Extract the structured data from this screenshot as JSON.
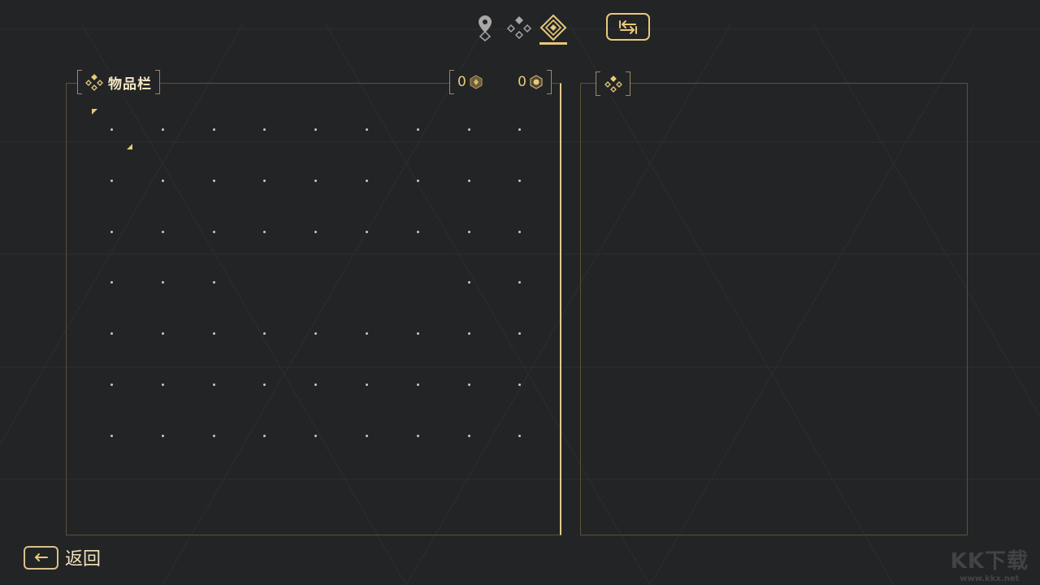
{
  "tabs": [
    {
      "icon": "map-pin-icon",
      "active": false
    },
    {
      "icon": "rune-diamond-icon",
      "active": false
    },
    {
      "icon": "inventory-diamond-icon",
      "active": true
    }
  ],
  "swap_button": {
    "icon": "swap-arrows-icon"
  },
  "inventory": {
    "title": "物品栏",
    "currencies": [
      {
        "value": "0",
        "icon": "rune-coin-icon"
      },
      {
        "value": "0",
        "icon": "hex-gem-icon"
      }
    ],
    "grid": {
      "columns": 9,
      "rows": 7,
      "empty_cells": [
        [
          3,
          3
        ],
        [
          3,
          4
        ],
        [
          3,
          5
        ],
        [
          3,
          6
        ]
      ]
    }
  },
  "back": {
    "label": "返回",
    "icon": "arrow-left-icon"
  },
  "watermark": {
    "text": "KK下载",
    "url_text": "www.kkx.net"
  },
  "colors": {
    "accent": "#e8c97a",
    "background": "#232426",
    "border": "#5b5136"
  }
}
